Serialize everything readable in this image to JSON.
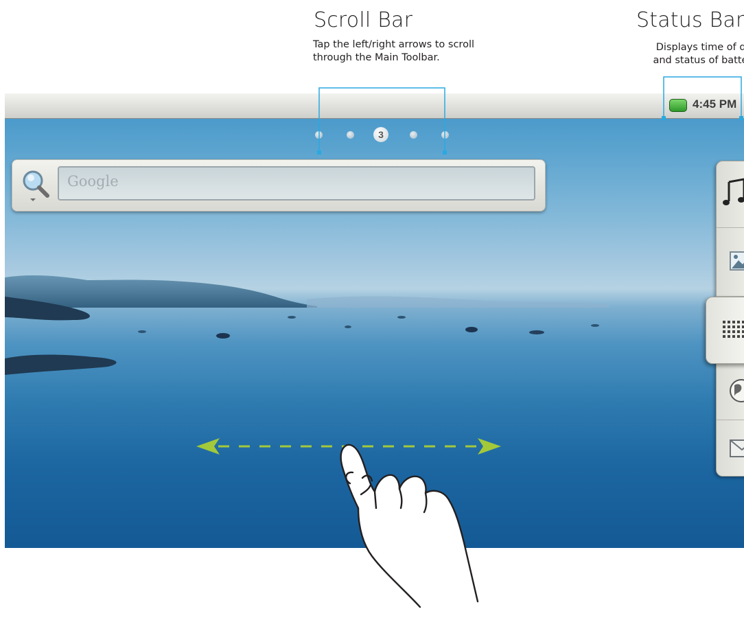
{
  "callouts": {
    "scroll_bar": {
      "title": "Scroll Bar",
      "description": "Tap the left/right arrows to scroll through the Main Toolbar."
    },
    "status_bar": {
      "title": "Status Bar",
      "description_line1": "Displays time of day",
      "description_line2": "and status of battery"
    }
  },
  "device": {
    "status_bar": {
      "time": "4:45 PM",
      "battery_color": "#3fb335"
    },
    "pager": {
      "current_page": "3",
      "total_dots": 5
    },
    "search": {
      "placeholder": "Google",
      "icon": "search-icon"
    },
    "dock": {
      "items": [
        {
          "name": "music",
          "icon": "music-note-icon"
        },
        {
          "name": "gallery",
          "icon": "picture-icon"
        },
        {
          "name": "apps",
          "icon": "app-grid-icon"
        },
        {
          "name": "browser",
          "icon": "globe-icon"
        },
        {
          "name": "email",
          "icon": "mail-icon"
        }
      ]
    }
  },
  "gesture": {
    "type": "swipe-left-right",
    "arrow_color": "#a3c93a",
    "icon": "hand-pointer-icon"
  },
  "colors": {
    "callout_line": "#29a9e0",
    "sky": "#3f93c8",
    "water": "#1c66a1"
  }
}
